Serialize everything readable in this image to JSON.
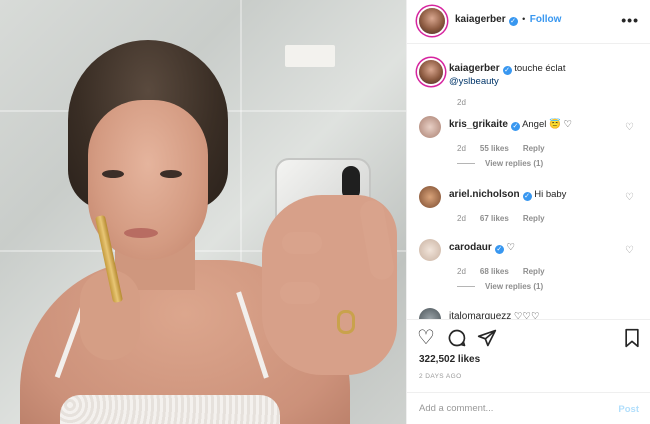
{
  "post": {
    "author": "kaiagerber",
    "follow_label": "Follow",
    "dot_separator": "•",
    "more_label": "•••",
    "caption_text": "touche éclat",
    "caption_mention": "@yslbeauty",
    "caption_time": "2d"
  },
  "comments": [
    {
      "user": "kris_grikaite",
      "text": "Angel 😇 ♡",
      "time": "2d",
      "likes": "55 likes",
      "reply_label": "Reply",
      "view_replies": "View replies (1)"
    },
    {
      "user": "ariel.nicholson",
      "text": "Hi baby",
      "time": "2d",
      "likes": "67 likes",
      "reply_label": "Reply"
    },
    {
      "user": "carodaur",
      "text": "♡",
      "time": "2d",
      "likes": "68 likes",
      "reply_label": "Reply",
      "view_replies": "View replies (1)"
    },
    {
      "user": "italomarquezz",
      "text": "♡♡♡"
    }
  ],
  "actions": {
    "likes_count": "322,502 likes",
    "date": "2 DAYS AGO",
    "comment_placeholder": "Add a comment...",
    "post_label": "Post"
  },
  "icons": [
    "verified-badge",
    "more-options",
    "heart",
    "comment",
    "share",
    "bookmark"
  ],
  "colors": {
    "accent": "#3897f0",
    "muted": "#8e8e8e",
    "post_disabled": "#b2dffc"
  }
}
